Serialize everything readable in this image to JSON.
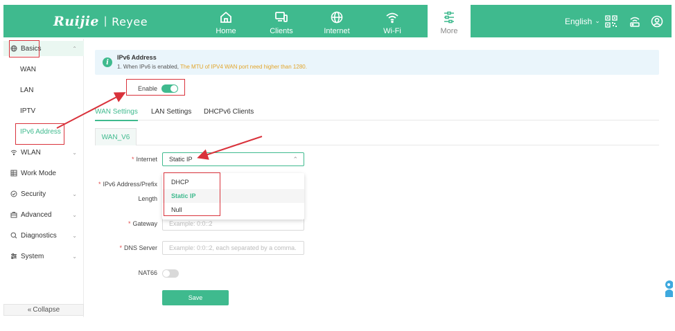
{
  "header": {
    "logo_main": "Ruijie",
    "logo_sub": "Reyee",
    "nav": [
      {
        "label": "Home",
        "icon": "home-icon"
      },
      {
        "label": "Clients",
        "icon": "devices-icon"
      },
      {
        "label": "Internet",
        "icon": "globe-icon"
      },
      {
        "label": "Wi-Fi",
        "icon": "wifi-icon"
      },
      {
        "label": "More",
        "icon": "sliders-icon"
      }
    ],
    "active_nav": "More",
    "language": "English",
    "right_icons": [
      "qr-code-icon",
      "router-icon",
      "user-icon"
    ]
  },
  "sidebar": {
    "items": [
      {
        "label": "Basics",
        "icon": "globe-icon",
        "expanded": true
      },
      {
        "label": "WAN"
      },
      {
        "label": "LAN"
      },
      {
        "label": "IPTV"
      },
      {
        "label": "IPv6 Address",
        "active": true
      },
      {
        "label": "WLAN",
        "icon": "wifi-icon"
      },
      {
        "label": "Work Mode",
        "icon": "grid-icon"
      },
      {
        "label": "Security",
        "icon": "shield-icon"
      },
      {
        "label": "Advanced",
        "icon": "briefcase-icon"
      },
      {
        "label": "Diagnostics",
        "icon": "search-icon"
      },
      {
        "label": "System",
        "icon": "sliders-icon"
      }
    ],
    "collapse_label": "Collapse"
  },
  "info": {
    "title": "IPv6 Address",
    "line_prefix": "1. When IPv6 is enabled, ",
    "line_warning": "The MTU of IPV4 WAN port need higher than 1280."
  },
  "enable": {
    "label": "Enable",
    "on": true
  },
  "tabs": [
    "WAN Settings",
    "LAN Settings",
    "DHCPv6 Clients"
  ],
  "active_tab": "WAN Settings",
  "subtab": "WAN_V6",
  "form": {
    "internet_label": "Internet",
    "internet_value": "Static IP",
    "ipv6_label_line1": "IPv6 Address/Prefix",
    "ipv6_label_line2": "Length",
    "gateway_label": "Gateway",
    "gateway_placeholder": "Example: 0:0::2",
    "dns_label": "DNS Server",
    "dns_placeholder": "Example: 0:0::2, each separated by a comma.",
    "nat66_label": "NAT66",
    "nat66_on": false,
    "save_label": "Save"
  },
  "dropdown": {
    "options": [
      "DHCP",
      "Static IP",
      "Null"
    ],
    "selected": "Static IP"
  },
  "colors": {
    "brand": "#3fba8e",
    "warning_text": "#e2a52a",
    "annotation": "#d9323b",
    "required": "#e24a4a"
  }
}
